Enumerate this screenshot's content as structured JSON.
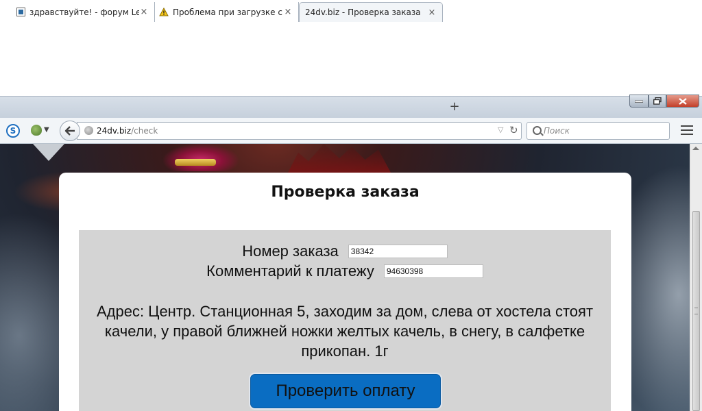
{
  "browser": {
    "tabs": [
      {
        "title": "здравствуйте! - форум Le...",
        "icon": "forum-favicon-icon"
      },
      {
        "title": "Проблема при загрузке с...",
        "icon": "warning-icon"
      },
      {
        "title": "24dv.biz - Проверка заказа",
        "icon": "none"
      }
    ],
    "new_tab_label": "+",
    "close_glyph": "×",
    "url_domain": "24dv.biz",
    "url_path": "/check",
    "search_placeholder": "Поиск"
  },
  "page": {
    "title": "Проверка заказа",
    "form": {
      "order_label": "Номер заказа",
      "order_value": "38342",
      "comment_label": "Комментарий к платежу",
      "comment_value": "94630398"
    },
    "address": "Адрес: Центр. Станционная 5, заходим за дом, слева от хостела стоят качели, у правой ближней ножки желтых качель, в снегу, в салфетке прикопан. 1г",
    "check_button": "Проверить оплату"
  },
  "colors": {
    "button_bg": "#0a6dc2",
    "form_bg": "#d4d4d4"
  }
}
